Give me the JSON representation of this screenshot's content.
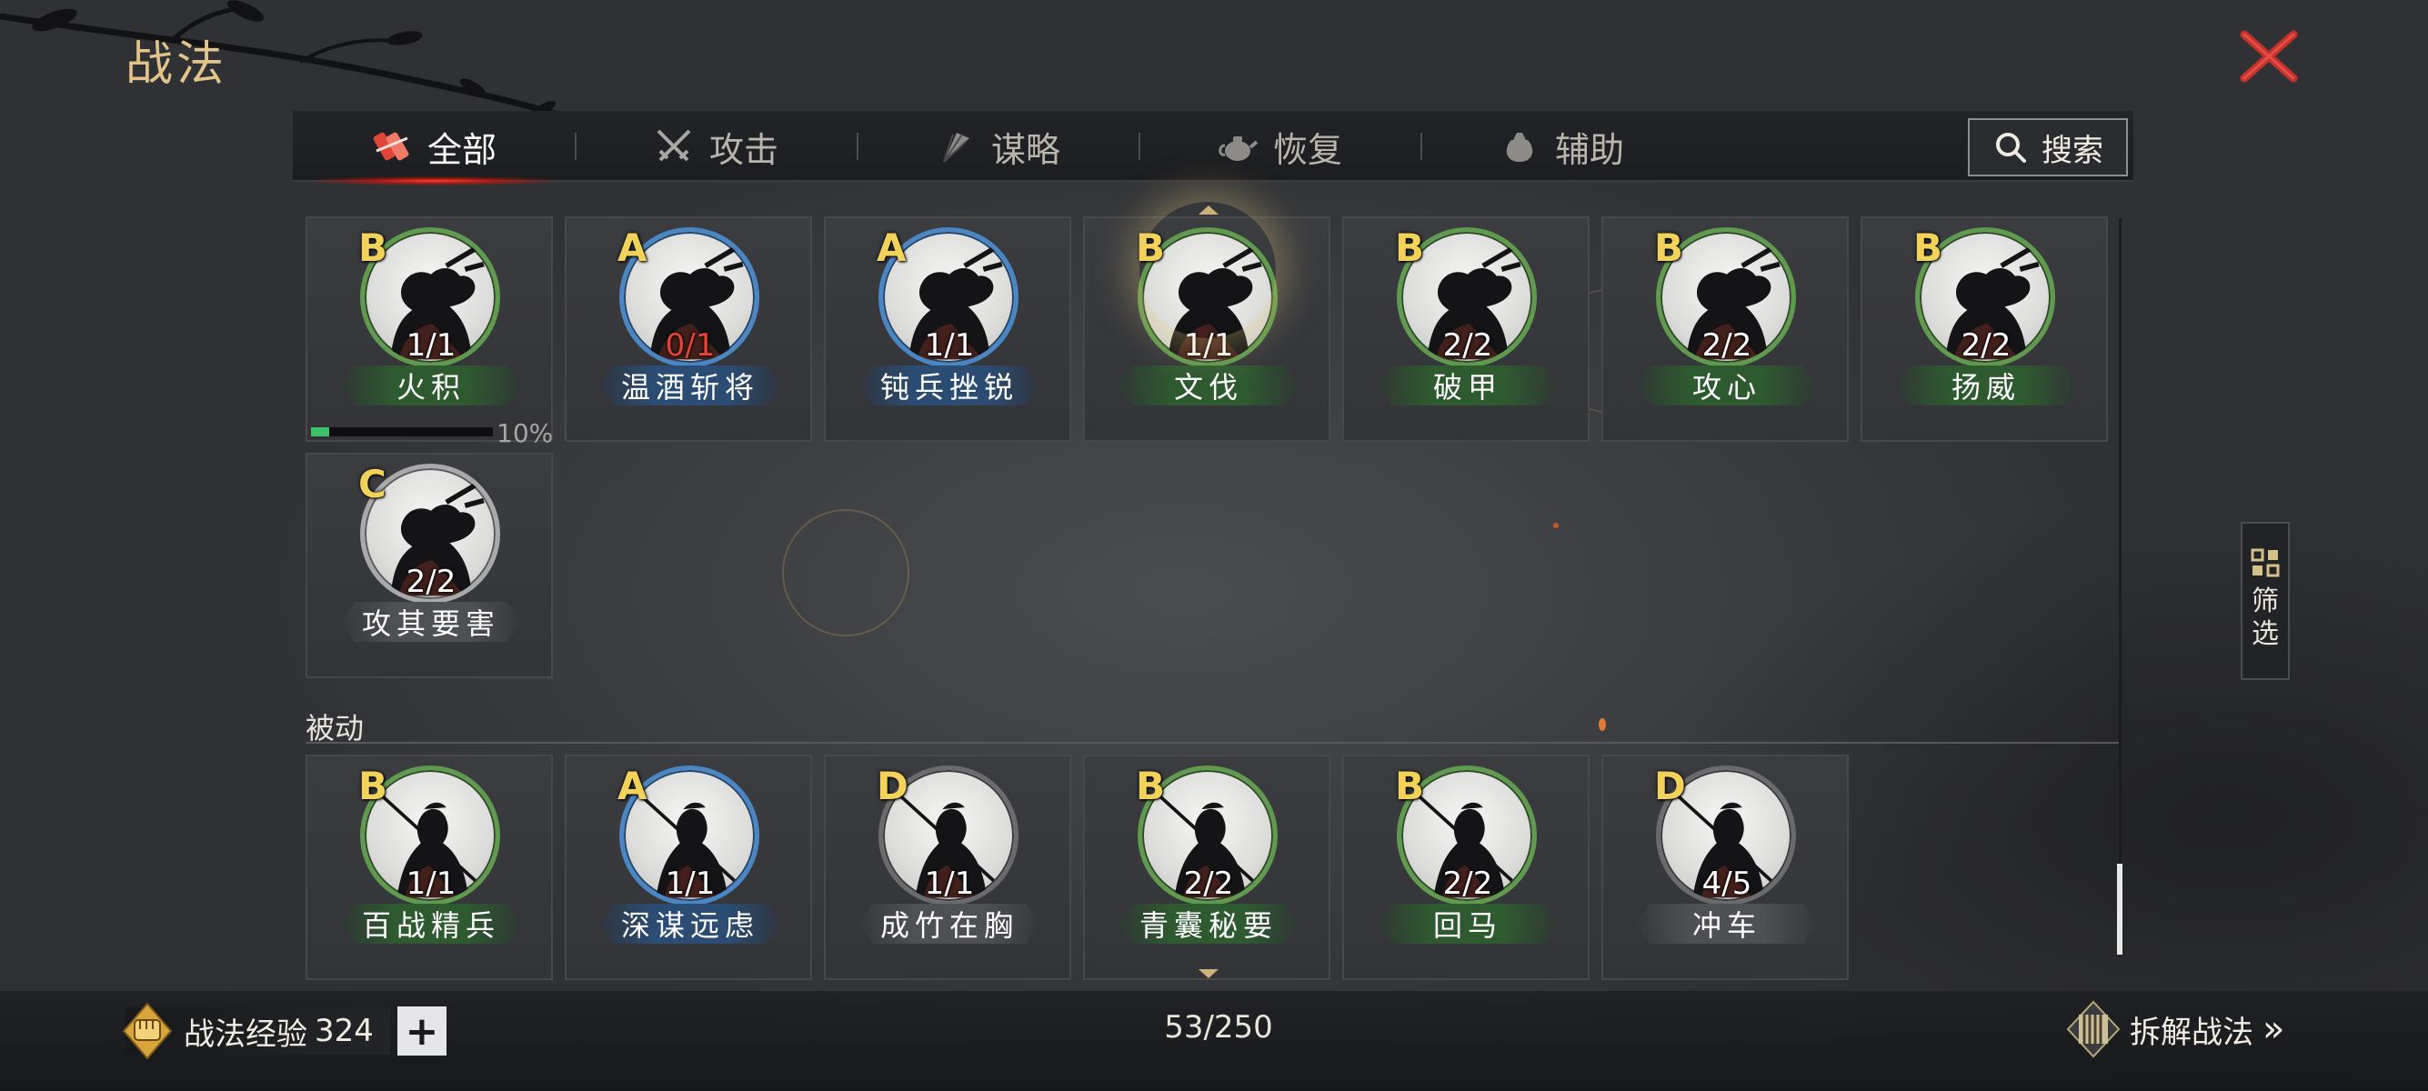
{
  "title": "战法",
  "tabs": [
    {
      "label": "全部",
      "icon": "scroll-bundle-icon",
      "active": true
    },
    {
      "label": "攻击",
      "icon": "crossed-swords-icon",
      "active": false
    },
    {
      "label": "谋略",
      "icon": "feather-fan-icon",
      "active": false
    },
    {
      "label": "恢复",
      "icon": "teapot-icon",
      "active": false
    },
    {
      "label": "辅助",
      "icon": "pouch-icon",
      "active": false
    }
  ],
  "search": {
    "label": "搜索",
    "icon": "search-icon"
  },
  "active_cards": [
    {
      "grade": "B",
      "count": "1/1",
      "name": "火积",
      "tier": "g",
      "progress": 0.1,
      "progress_label": "10%"
    },
    {
      "grade": "A",
      "count": "0/1",
      "name": "温酒斩将",
      "tier": "b",
      "count_alert": true
    },
    {
      "grade": "A",
      "count": "1/1",
      "name": "钝兵挫锐",
      "tier": "b"
    },
    {
      "grade": "B",
      "count": "1/1",
      "name": "文伐",
      "tier": "g",
      "highlight": true
    },
    {
      "grade": "B",
      "count": "2/2",
      "name": "破甲",
      "tier": "g"
    },
    {
      "grade": "B",
      "count": "2/2",
      "name": "攻心",
      "tier": "g"
    },
    {
      "grade": "B",
      "count": "2/2",
      "name": "扬威",
      "tier": "g"
    },
    {
      "grade": "C",
      "count": "2/2",
      "name": "攻其要害",
      "tier": "w"
    }
  ],
  "passive_section_label": "被动",
  "passive_cards": [
    {
      "grade": "B",
      "count": "1/1",
      "name": "百战精兵",
      "tier": "g"
    },
    {
      "grade": "A",
      "count": "1/1",
      "name": "深谋远虑",
      "tier": "b"
    },
    {
      "grade": "D",
      "count": "1/1",
      "name": "成竹在胸",
      "tier": "w"
    },
    {
      "grade": "B",
      "count": "2/2",
      "name": "青囊秘要",
      "tier": "g"
    },
    {
      "grade": "B",
      "count": "2/2",
      "name": "回马",
      "tier": "g"
    },
    {
      "grade": "D",
      "count": "4/5",
      "name": "冲车",
      "tier": "w"
    }
  ],
  "filter": {
    "label": "筛选",
    "icon": "grid-filter-icon"
  },
  "bottom": {
    "exp_label": "战法经验",
    "exp_value": "324",
    "exp_icon": "fist-badge-icon",
    "plus_label": "+",
    "capacity": "53/250",
    "dismantle_label": "拆解战法",
    "dismantle_icon": "scroll-bars-icon",
    "dismantle_arrow": "»"
  },
  "colors": {
    "title_gold": "#e2c48a",
    "grade_yellow": "#f3d25a",
    "close_red": "#c8302a",
    "tier_green": "#5f9a4e",
    "tier_blue": "#4b86c4",
    "tier_white": "#a9a9ab",
    "progress_green": "#3fbf6a",
    "count_alert_red": "#e2453a"
  }
}
